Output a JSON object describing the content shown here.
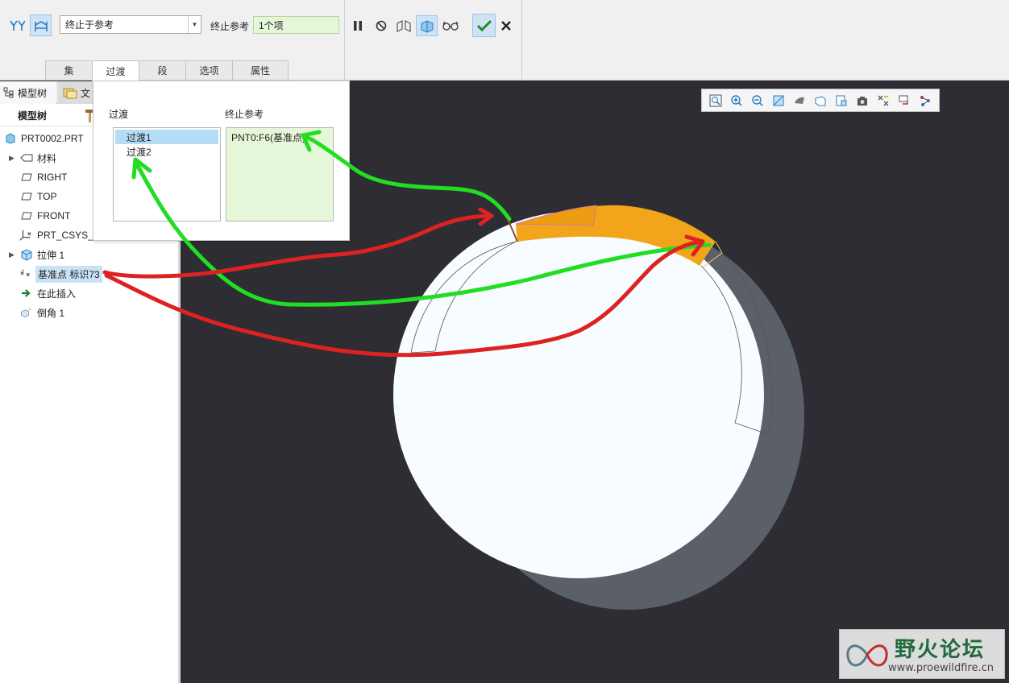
{
  "ribbon": {
    "end_condition": "终止于参考",
    "end_ref_label": "终止参考",
    "end_ref_count": "1个项"
  },
  "tabs": [
    {
      "label": "集"
    },
    {
      "label": "过渡"
    },
    {
      "label": "段"
    },
    {
      "label": "选项"
    },
    {
      "label": "属性"
    }
  ],
  "left_panel": {
    "tab_tree": "模型树",
    "tab_folder": "文",
    "tree_header": "模型树",
    "items": [
      {
        "label": "PRT0002.PRT",
        "icon": "part-icon"
      },
      {
        "label": "材料",
        "icon": "material-icon"
      },
      {
        "label": "RIGHT",
        "icon": "datum-plane-icon"
      },
      {
        "label": "TOP",
        "icon": "datum-plane-icon"
      },
      {
        "label": "FRONT",
        "icon": "datum-plane-icon"
      },
      {
        "label": "PRT_CSYS_D",
        "icon": "csys-icon"
      },
      {
        "label": "拉伸 1",
        "icon": "extrude-icon"
      },
      {
        "label": "基准点 标识73",
        "icon": "datum-point-icon"
      },
      {
        "label": "在此插入",
        "icon": "insert-arrow-icon"
      },
      {
        "label": "倒角 1",
        "icon": "chamfer-icon"
      }
    ]
  },
  "popup": {
    "transitions_label": "过渡",
    "end_ref_label": "终止参考",
    "transitions": [
      "过渡1",
      "过渡2"
    ],
    "end_ref_value": "PNT0:F6(基准点)"
  },
  "watermark": {
    "title": "野火论坛",
    "url": "www.proewildfire.cn"
  },
  "colors": {
    "accent_green": "#22dd22",
    "accent_red": "#dd2222",
    "chamfer_orange": "#f2a41a"
  }
}
